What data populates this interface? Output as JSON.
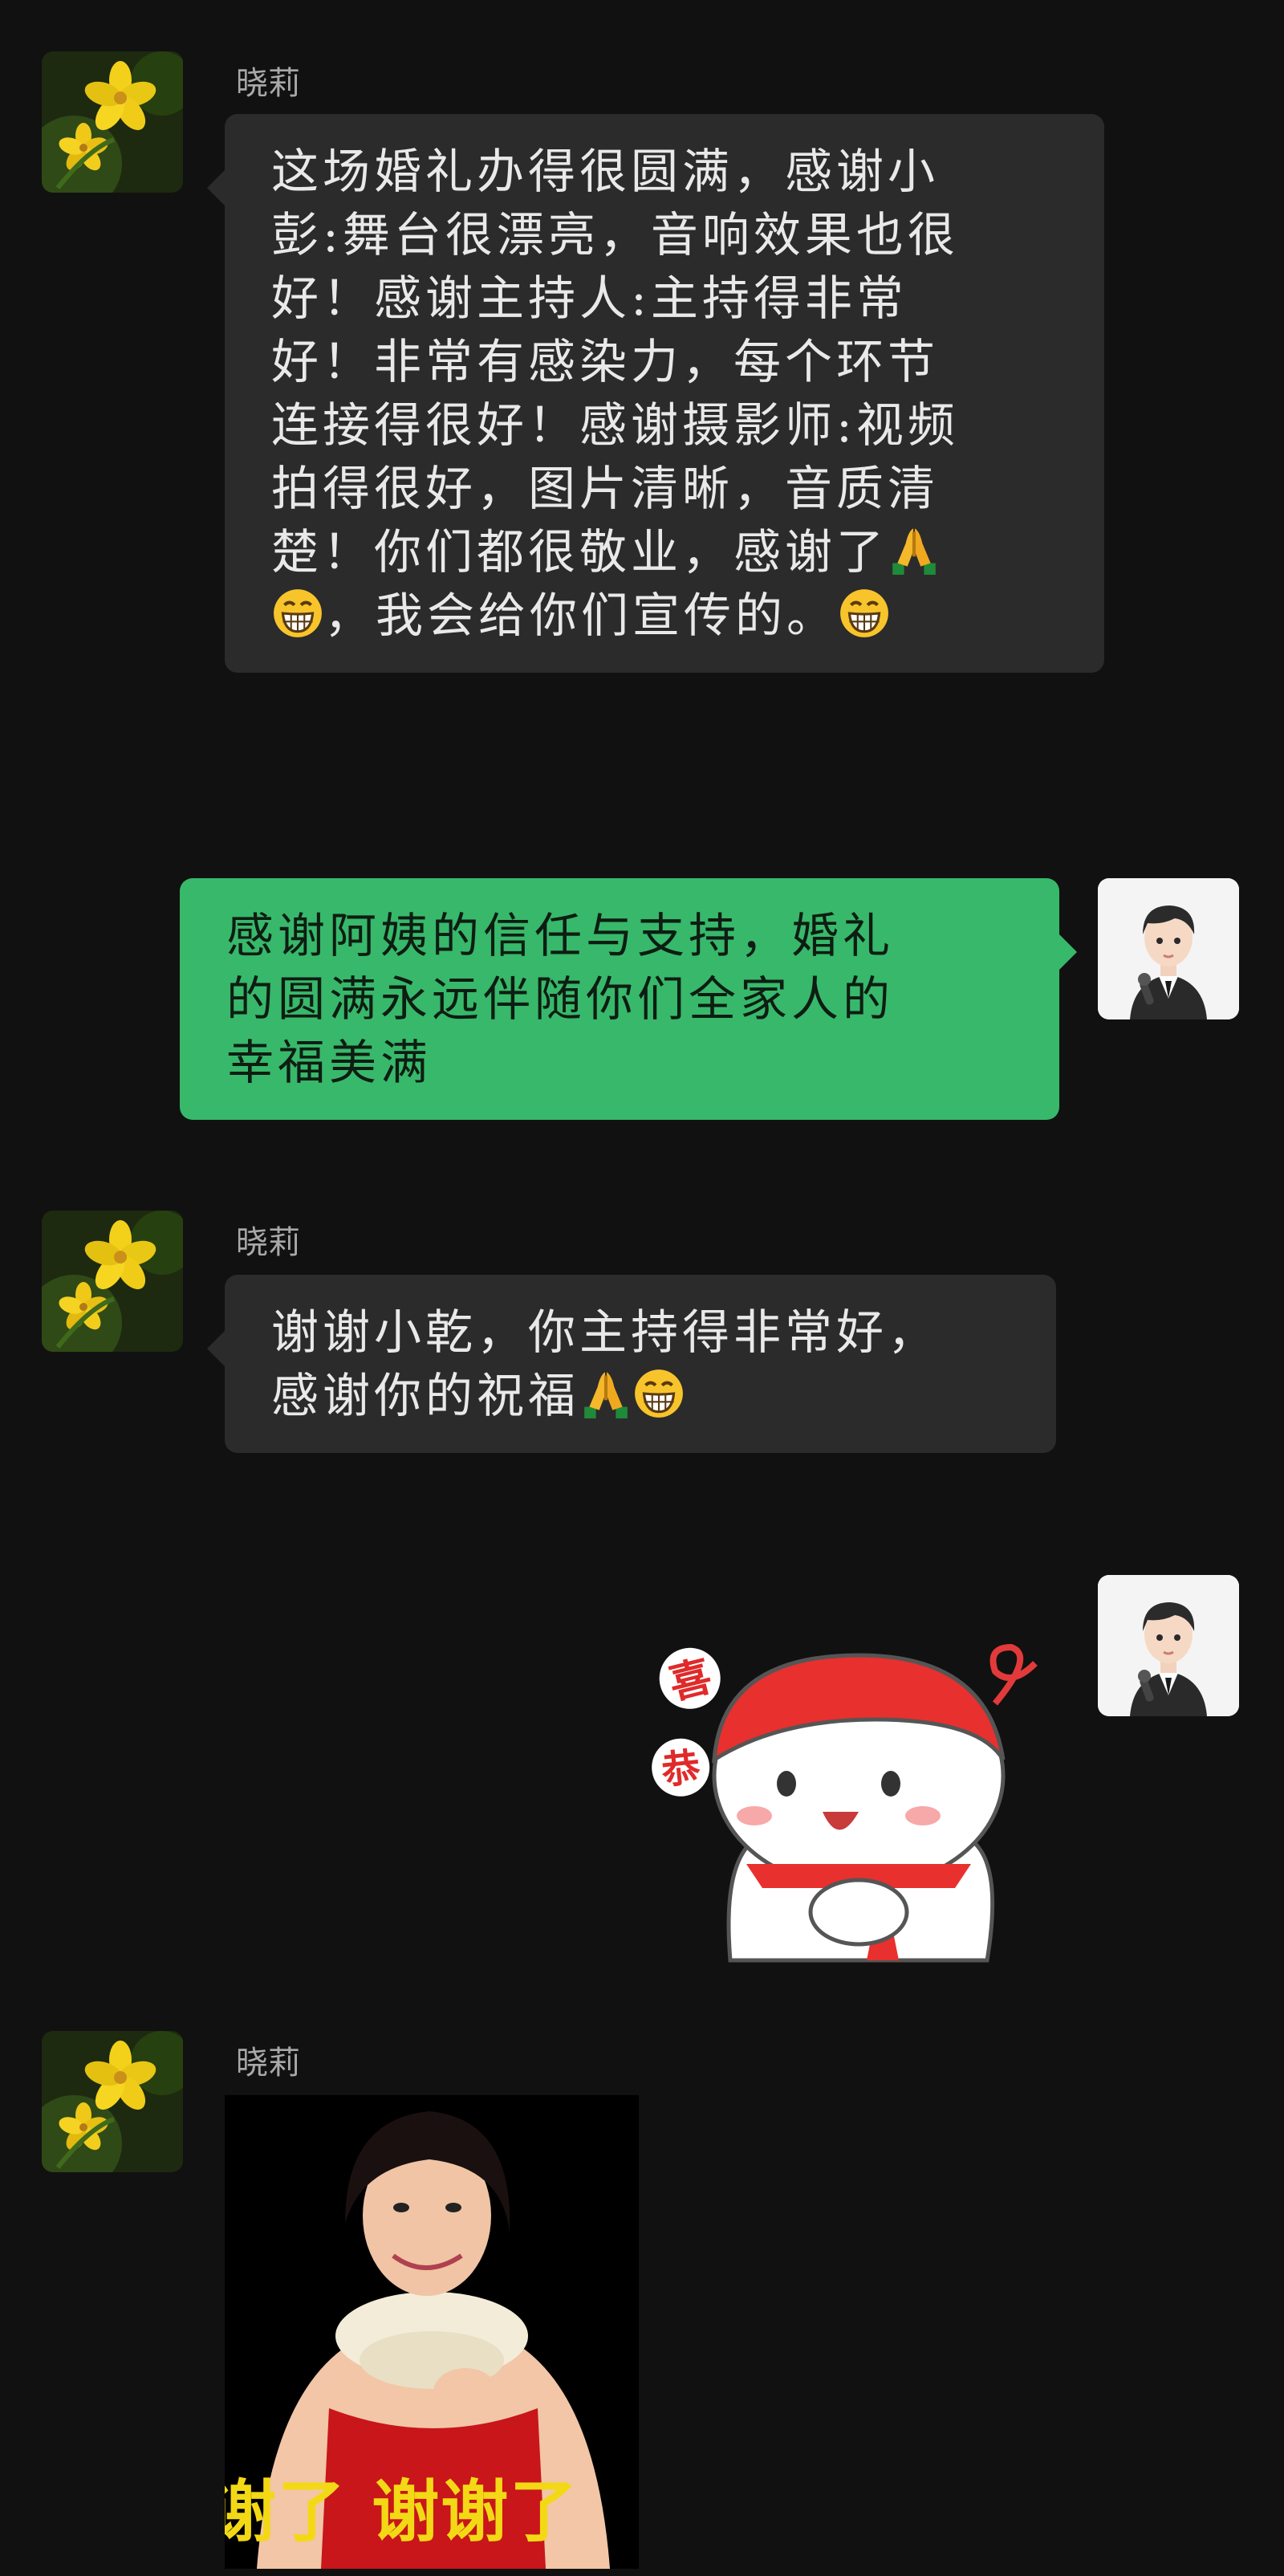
{
  "chat": {
    "contact_name": "晓莉",
    "messages": [
      {
        "sender": "晓莉",
        "direction": "incoming",
        "type": "text",
        "lines": [
          "这场婚礼办得很圆满，感谢小",
          "彭:舞台很漂亮，音响效果也很",
          "好！感谢主持人:主持得非常",
          "好！非常有感染力，每个环节",
          "连接得很好！感谢摄影师:视频",
          "拍得很好，图片清晰，音质清",
          "楚！你们都很敬业，感谢了",
          "，我会给你们宣传的。"
        ],
        "emojis": [
          "folded-hands",
          "grinning-face",
          "grinning-face"
        ]
      },
      {
        "direction": "outgoing",
        "type": "text",
        "lines": [
          "感谢阿姨的信任与支持，婚礼",
          "的圆满永远伴随你们全家人的",
          "幸福美满"
        ]
      },
      {
        "sender": "晓莉",
        "direction": "incoming",
        "type": "text",
        "lines": [
          "谢谢小乾，你主持得非常好，",
          "感谢你的祝福"
        ],
        "emojis": [
          "folded-hands",
          "grinning-face"
        ]
      },
      {
        "direction": "outgoing",
        "type": "sticker",
        "sticker_text": [
          "喜",
          "恭"
        ]
      },
      {
        "sender": "晓莉",
        "direction": "incoming",
        "type": "image",
        "caption": "谢了  谢谢了"
      }
    ]
  },
  "colors": {
    "background": "#111111",
    "incoming_bubble": "#2b2b2b",
    "outgoing_bubble": "#38b86b",
    "caption_yellow": "#f3d915"
  },
  "icons": [
    "flower-avatar-icon",
    "host-avatar-icon",
    "folded-hands-emoji",
    "grinning-face-emoji"
  ]
}
